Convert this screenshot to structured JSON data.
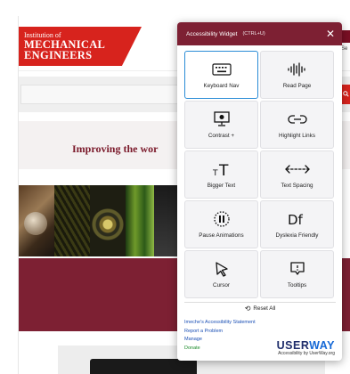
{
  "site": {
    "logo_line1": "Institution of",
    "logo_line2": "MECHANICAL",
    "logo_line3": "ENGINEERS",
    "right_small": "Se",
    "hero_title": "Improving the wor",
    "search_icon": "search-icon"
  },
  "widget": {
    "title": "Accessibility Widget",
    "shortcut": "(CTRL+U)",
    "close": "✕",
    "tiles": [
      {
        "label": "Keyboard Nav",
        "icon": "keyboard-icon"
      },
      {
        "label": "Read Page",
        "icon": "soundwave-icon"
      },
      {
        "label": "Contrast +",
        "icon": "contrast-icon"
      },
      {
        "label": "Highlight Links",
        "icon": "link-icon"
      },
      {
        "label": "Bigger Text",
        "icon": "text-size-icon"
      },
      {
        "label": "Text Spacing",
        "icon": "text-spacing-icon"
      },
      {
        "label": "Pause Animations",
        "icon": "pause-icon"
      },
      {
        "label": "Dyslexia Friendly",
        "icon": "dyslexia-icon"
      },
      {
        "label": "Cursor",
        "icon": "cursor-icon"
      },
      {
        "label": "Tooltips",
        "icon": "tooltip-icon"
      }
    ],
    "reset_label": "Reset All",
    "links": {
      "statement": "Imeche's Accessibility Statement",
      "report": "Report a Problem",
      "manage": "Manage",
      "donate": "Donate"
    },
    "brand_part1": "USER",
    "brand_part2": "WAY",
    "brand_sub": "Accessibility by UserWay.org"
  },
  "colors": {
    "maroon": "#7d2033",
    "brand_red": "#d7231d",
    "active_border": "#2a8cd6",
    "link_blue": "#1a4fb5",
    "donate_green": "#1a8a2a"
  }
}
